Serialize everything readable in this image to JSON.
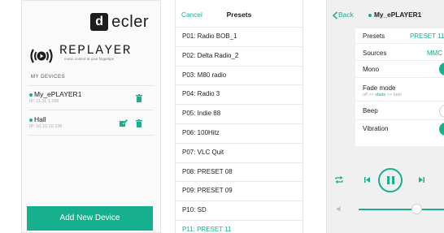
{
  "screen1": {
    "brand": {
      "mark": "d",
      "name": "ecler"
    },
    "product": {
      "name": "REPLAYER",
      "tagline": "music control at your fingertips"
    },
    "section_label": "MY DEVICES",
    "devices": [
      {
        "name": "My_ePLAYER1",
        "ip": "IP: 11.11.1.106"
      },
      {
        "name": "Hall",
        "ip": "IP: 10.10.10.106"
      }
    ],
    "add_button": "Add New Device"
  },
  "screen2": {
    "cancel": "Cancel",
    "title": "Presets",
    "presets": [
      "P01: Radio BOB_1",
      "P02: Delta Radio_2",
      "P03: M80 radio",
      "P04: Radio 3",
      "P05: Indie 88",
      "P06: 100Hitz",
      "P07: VLC Quit",
      "P08: PRESET 08",
      "P09: PRESET 09",
      "P10: SD",
      "P11: PRESET 11"
    ],
    "selected_index": 10
  },
  "screen3": {
    "back": "Back",
    "player": "My_ePLAYER1",
    "rows": {
      "presets_label": "Presets",
      "presets_value": "PRESET 11",
      "sources_label": "Sources",
      "sources_value": "MMC",
      "mono_label": "Mono",
      "mono_on": true,
      "fade_label": "Fade mode",
      "fade_off": "off >> ",
      "fade_xfade": "xfade",
      "fade_rest": " >> fade",
      "beep_label": "Beep",
      "beep_on": false,
      "vibration_label": "Vibration",
      "vibration_on": true
    },
    "volume_fraction": 0.5
  },
  "colors": {
    "accent": "#16b08f"
  }
}
